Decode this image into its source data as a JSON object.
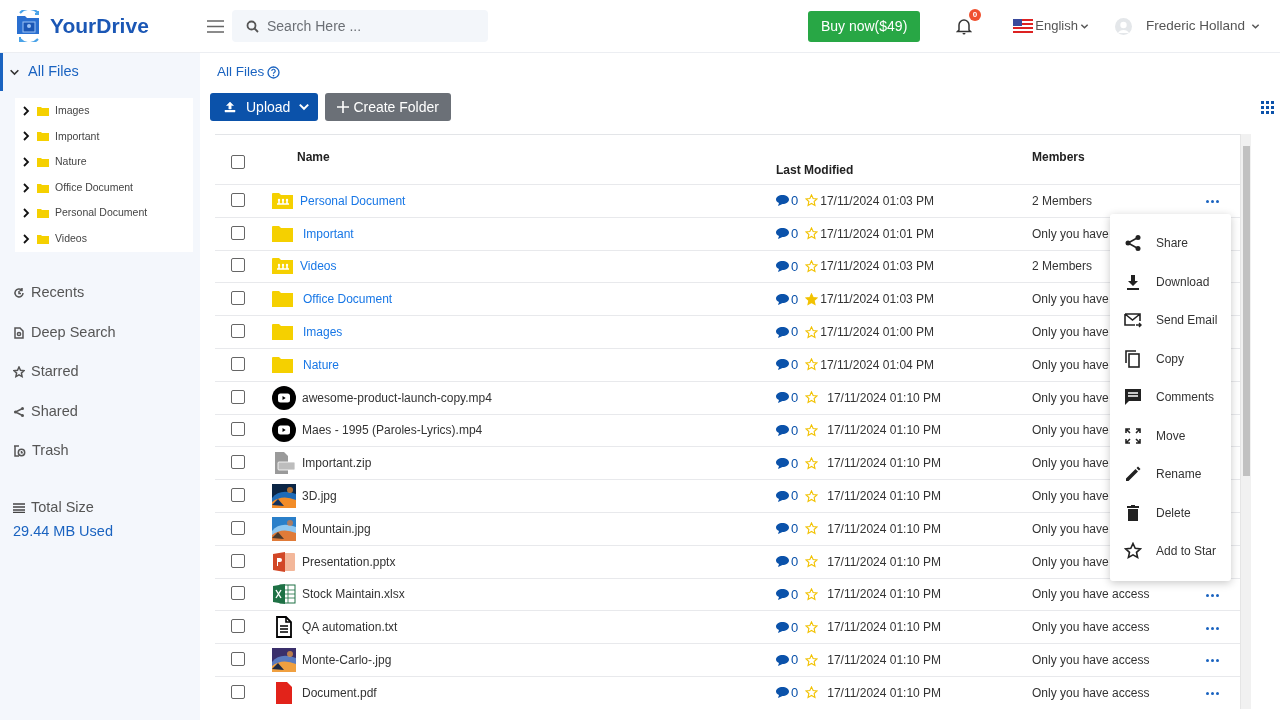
{
  "header": {
    "logo": "YourDrive",
    "search": {
      "placeholder": "Search Here ..."
    },
    "buy_button": "Buy now($49)",
    "notifications": {
      "count": "0"
    },
    "language": "English",
    "user": "Frederic Holland"
  },
  "sidebar": {
    "root": {
      "label": "All Files",
      "expanded": true,
      "selected": true
    },
    "folders": [
      {
        "label": "Images",
        "expanded": false
      },
      {
        "label": "Important",
        "expanded": false
      },
      {
        "label": "Nature",
        "expanded": false
      },
      {
        "label": "Office Document",
        "expanded": false
      },
      {
        "label": "Personal Document",
        "expanded": false
      },
      {
        "label": "Videos",
        "expanded": false
      }
    ],
    "nav": [
      {
        "label": "Recents",
        "kind": "recents"
      },
      {
        "label": "Deep Search",
        "kind": "search"
      },
      {
        "label": "Starred",
        "kind": "starred"
      },
      {
        "label": "Shared",
        "kind": "shared"
      },
      {
        "label": "Trash",
        "kind": "trash"
      }
    ],
    "storage": {
      "label": "Total Size",
      "value": "29.44 MB Used"
    }
  },
  "breadcrumb": "All Files",
  "toolbar": {
    "upload": "Upload",
    "create_folder": "Create Folder"
  },
  "table": {
    "columns": [
      "Name",
      "Last Modified",
      "Members"
    ],
    "all_checked": false,
    "rows": [
      {
        "kind": "shared-folder",
        "name": "Personal Document",
        "comments": "0",
        "starred": false,
        "modified": "17/11/2024 01:03 PM",
        "members": "2 Members",
        "checked": false
      },
      {
        "kind": "folder",
        "name": "Important",
        "comments": "0",
        "starred": false,
        "modified": "17/11/2024 01:01 PM",
        "members": "Only you have",
        "checked": false
      },
      {
        "kind": "shared-folder",
        "name": "Videos",
        "comments": "0",
        "starred": false,
        "modified": "17/11/2024 01:03 PM",
        "members": "2 Members",
        "checked": false
      },
      {
        "kind": "folder",
        "name": "Office Document",
        "comments": "0",
        "starred": true,
        "modified": "17/11/2024 01:03 PM",
        "members": "Only you have",
        "checked": false
      },
      {
        "kind": "folder",
        "name": "Images",
        "comments": "0",
        "starred": false,
        "modified": "17/11/2024 01:00 PM",
        "members": "Only you have",
        "checked": false
      },
      {
        "kind": "folder",
        "name": "Nature",
        "comments": "0",
        "starred": false,
        "modified": "17/11/2024 01:04 PM",
        "members": "Only you have",
        "checked": false
      },
      {
        "kind": "video",
        "name": "awesome-product-launch-copy.mp4",
        "comments": "0",
        "starred": false,
        "modified": "17/11/2024 01:10 PM",
        "members": "Only you have",
        "checked": false
      },
      {
        "kind": "video",
        "name": "Maes - 1995 (Paroles-Lyrics).mp4",
        "comments": "0",
        "starred": false,
        "modified": "17/11/2024 01:10 PM",
        "members": "Only you have",
        "checked": false
      },
      {
        "kind": "zip",
        "name": "Important.zip",
        "comments": "0",
        "starred": false,
        "modified": "17/11/2024 01:10 PM",
        "members": "Only you have",
        "checked": false
      },
      {
        "name": "3D.jpg",
        "comments": "0",
        "starred": false,
        "modified": "17/11/2024 01:10 PM",
        "members": "Only you have",
        "checked": false
      },
      {
        "name": "Mountain.jpg",
        "comments": "0",
        "starred": false,
        "modified": "17/11/2024 01:10 PM",
        "members": "Only you have",
        "checked": false
      },
      {
        "kind": "pptx",
        "name": "Presentation.pptx",
        "comments": "0",
        "starred": false,
        "modified": "17/11/2024 01:10 PM",
        "members": "Only you have",
        "checked": false
      },
      {
        "kind": "xlsx",
        "name": "Stock Maintain.xlsx",
        "comments": "0",
        "starred": false,
        "modified": "17/11/2024 01:10 PM",
        "members": "Only you have access",
        "checked": false
      },
      {
        "kind": "txt",
        "name": "QA automation.txt",
        "comments": "0",
        "starred": false,
        "modified": "17/11/2024 01:10 PM",
        "members": "Only you have access",
        "checked": false
      },
      {
        "name": "Monte-Carlo-.jpg",
        "comments": "0",
        "starred": false,
        "modified": "17/11/2024 01:10 PM",
        "members": "Only you have access",
        "checked": false
      },
      {
        "kind": "pdf",
        "name": "Document.pdf",
        "comments": "0",
        "starred": false,
        "modified": "17/11/2024 01:10 PM",
        "members": "Only you have access",
        "checked": false
      }
    ]
  },
  "context_menu": [
    {
      "label": "Share",
      "kind": "share"
    },
    {
      "label": "Download",
      "kind": "download"
    },
    {
      "label": "Send Email",
      "kind": "email"
    },
    {
      "label": "Copy",
      "kind": "copy"
    },
    {
      "label": "Comments",
      "kind": "comments"
    },
    {
      "label": "Move",
      "kind": "move"
    },
    {
      "label": "Rename",
      "kind": "rename"
    },
    {
      "label": "Delete",
      "kind": "delete"
    },
    {
      "label": "Add to Star",
      "kind": "star"
    }
  ]
}
